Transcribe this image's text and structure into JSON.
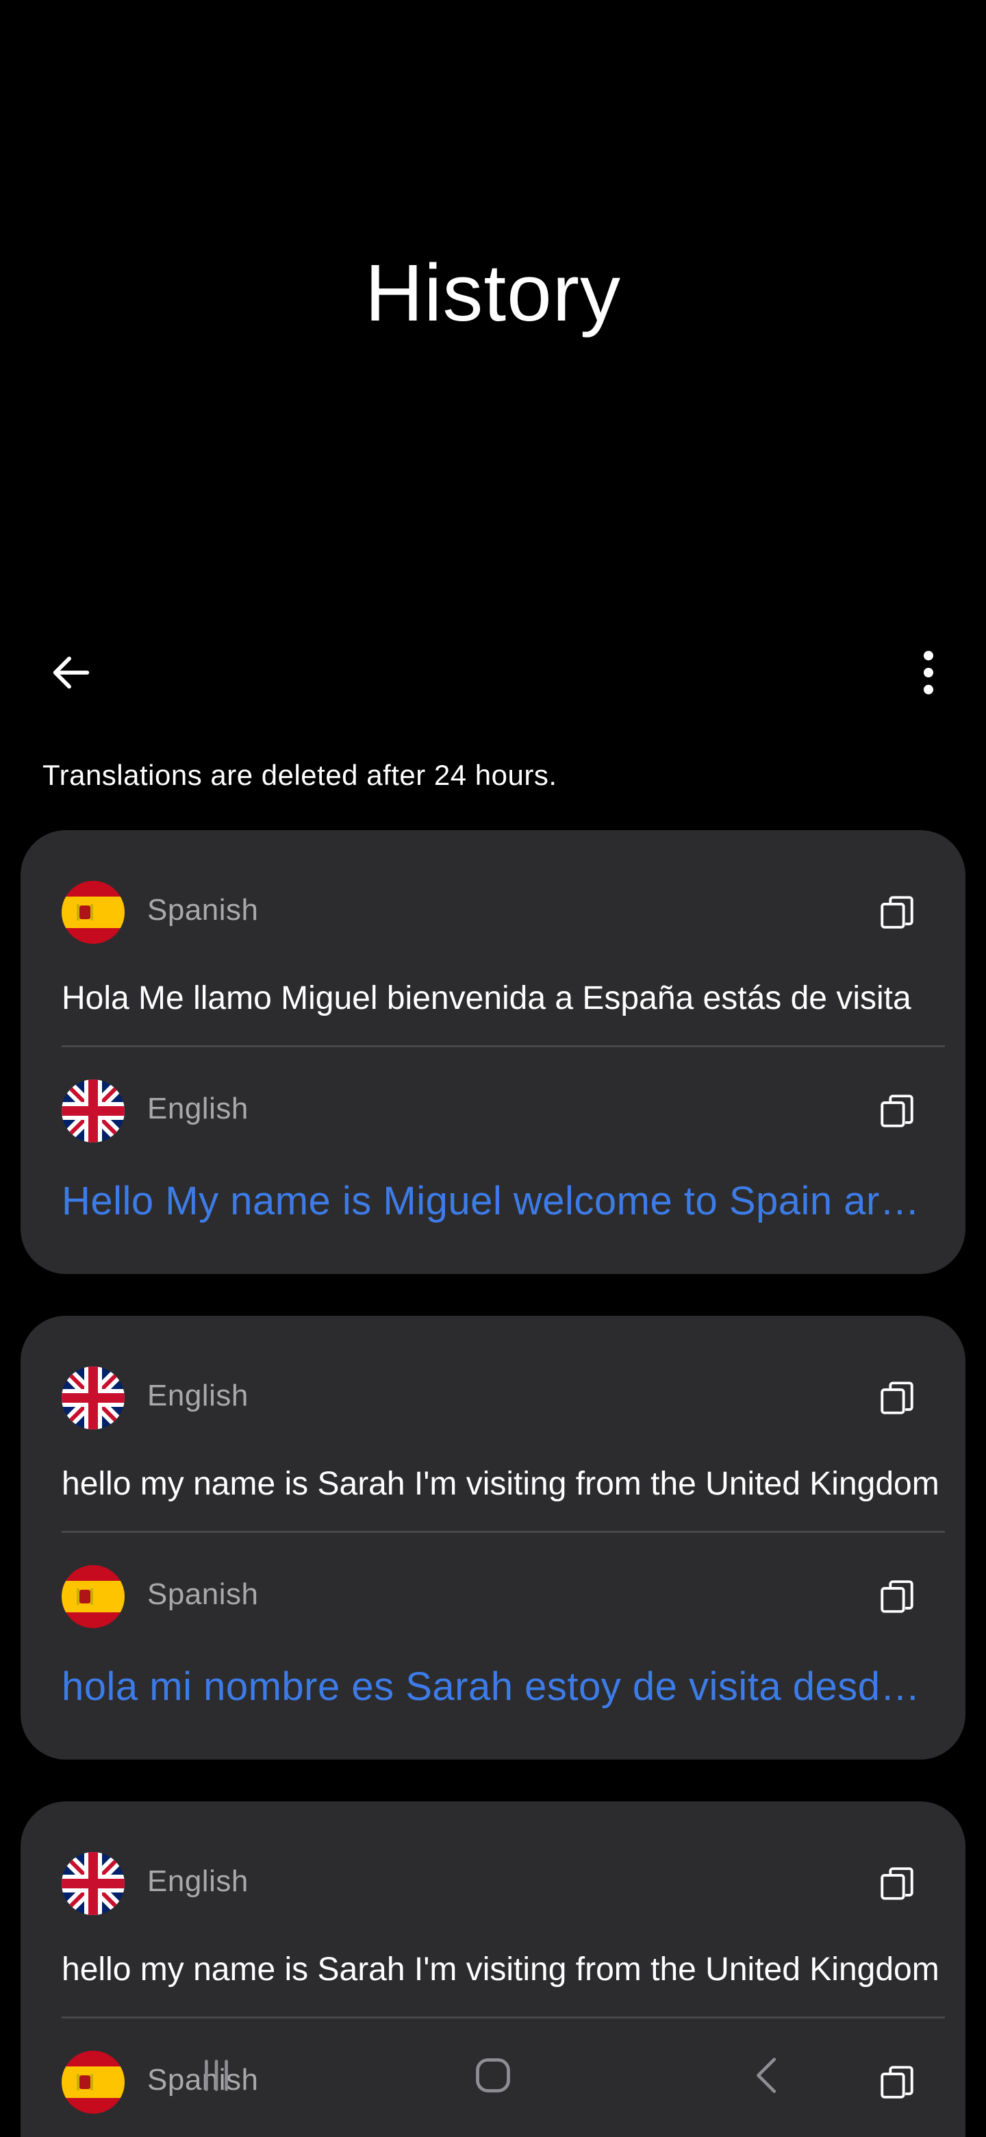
{
  "header": {
    "title": "History"
  },
  "toolbar": {
    "back_icon": "arrow-left-icon",
    "more_icon": "more-vert-icon"
  },
  "notice": "Translations are deleted after 24 hours.",
  "cards": [
    {
      "source": {
        "flag": "spain-flag",
        "language": "Spanish",
        "text": "Hola Me llamo Miguel bienvenida a España estás de visita"
      },
      "target": {
        "flag": "uk-flag",
        "language": "English",
        "text": "Hello My name is Miguel welcome to Spain are you visiting"
      }
    },
    {
      "source": {
        "flag": "uk-flag",
        "language": "English",
        "text": "hello my name is Sarah I'm visiting from the United Kingdom"
      },
      "target": {
        "flag": "spain-flag",
        "language": "Spanish",
        "text": "hola mi nombre es Sarah estoy de visita desde el Reino Unido"
      }
    },
    {
      "source": {
        "flag": "uk-flag",
        "language": "English",
        "text": "hello my name is Sarah I'm visiting from the United Kingdom"
      },
      "target": {
        "flag": "spain-flag",
        "language": "Spanish",
        "text": ""
      }
    }
  ],
  "colors": {
    "background": "#000000",
    "card": "#2c2c2e",
    "translated_text": "#3d7ce8",
    "language_label": "#a9a9ab"
  },
  "navbar": {
    "icons": [
      "recent-apps-icon",
      "home-icon",
      "back-icon"
    ]
  }
}
